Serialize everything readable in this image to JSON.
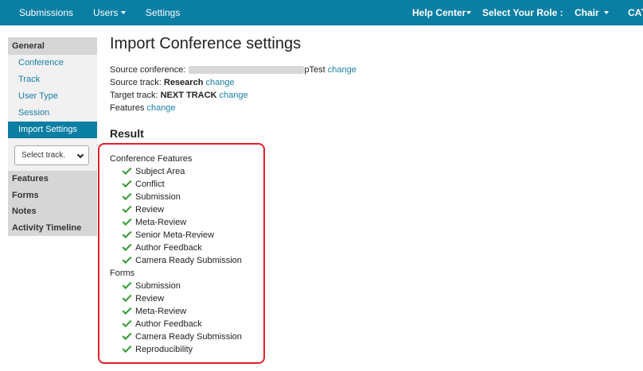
{
  "nav": {
    "submissions": "Submissions",
    "users": "Users",
    "settings": "Settings",
    "help_center": "Help Center",
    "select_role": "Select Your Role :",
    "role": "Chair",
    "overflow": "CAT"
  },
  "sidebar": {
    "general": "General",
    "links": [
      "Conference",
      "Track",
      "User Type",
      "Session",
      "Import Settings"
    ],
    "active_link": "Import Settings",
    "track_select_value": "Select track.",
    "groups": [
      "Features",
      "Forms",
      "Notes",
      "Activity Timeline"
    ]
  },
  "main": {
    "title": "Import Conference settings",
    "source_conference_label": "Source conference:",
    "source_conference_value_suffix": "pTest",
    "source_track_label": "Source track:",
    "source_track_value": "Research",
    "target_track_label": "Target track:",
    "target_track_value": "NEXT TRACK",
    "features_label": "Features",
    "change": "change",
    "result_title": "Result"
  },
  "result": {
    "conference_features_heading": "Conference Features",
    "conference_features": [
      "Subject Area",
      "Conflict",
      "Submission",
      "Review",
      "Meta-Review",
      "Senior Meta-Review",
      "Author Feedback",
      "Camera Ready Submission"
    ],
    "forms_heading": "Forms",
    "forms": [
      "Submission",
      "Review",
      "Meta-Review",
      "Author Feedback",
      "Camera Ready Submission",
      "Reproducibility"
    ],
    "check_color": "#2e9b2e",
    "highlight_color": "#e0202a"
  },
  "colors": {
    "brand": "#0b7ea3",
    "link": "#1a7fa5"
  }
}
